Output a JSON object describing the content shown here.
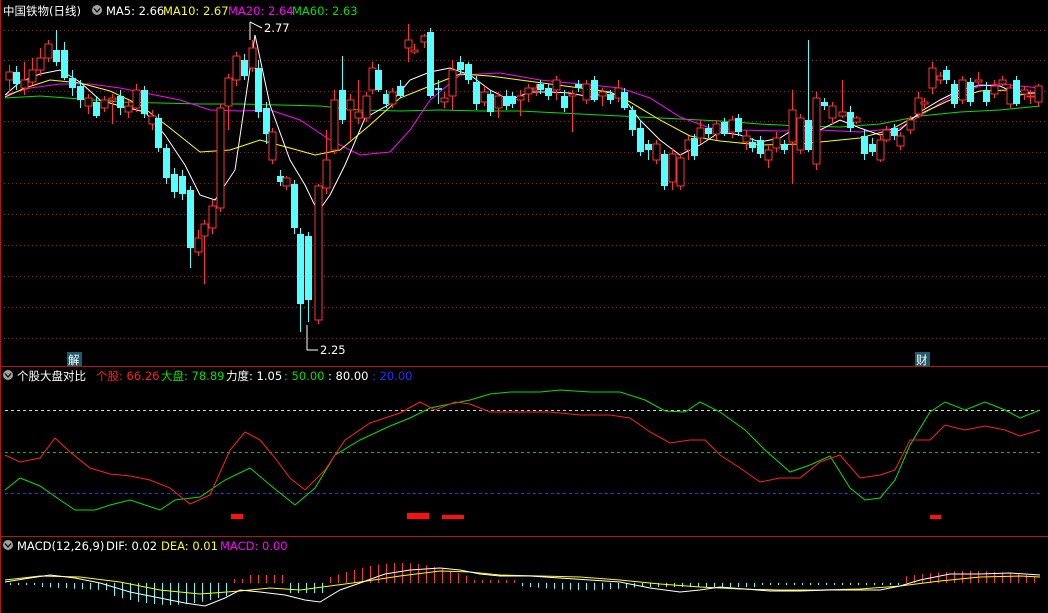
{
  "main": {
    "stock_name": "中国铁物(日线)",
    "ma5_label": "MA5: 2.66",
    "ma10_label": "MA10: 2.67",
    "ma20_label": "MA20: 2.64",
    "ma60_label": "MA60: 2.63",
    "high_marker": "2.77",
    "low_marker": "2.25",
    "event_markers": [
      "解",
      "财"
    ],
    "colors": {
      "ma5": "#ffffff",
      "ma10": "#ffff00",
      "ma20": "#ff00ff",
      "ma60": "#00e000",
      "up": "#ff3333",
      "down": "#54ffff"
    }
  },
  "indicator": {
    "name": "个股大盘对比",
    "stock_label": "个股: 66.26",
    "market_label": "大盘: 78.89",
    "force_label": "力度: 1.05",
    "level_50": ": 50.00",
    "level_80": ": 80.00",
    "level_20": ": 20.00"
  },
  "macd": {
    "name": "MACD(12,26,9)",
    "dif_label": "DIF: 0.02",
    "dea_label": "DEA: 0.01",
    "macd_label": "MACD: 0.00"
  }
}
